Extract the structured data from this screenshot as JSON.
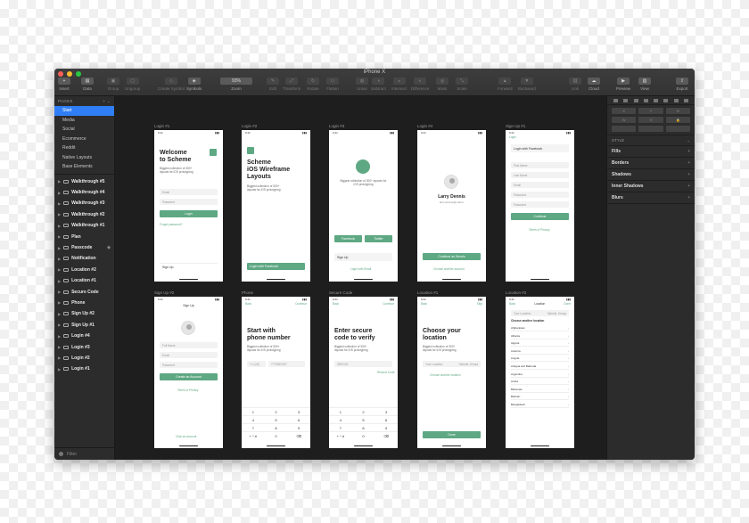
{
  "window": {
    "title": "iPhone X",
    "toolbar": [
      {
        "label": "Insert",
        "icon": "+"
      },
      {
        "label": "Data",
        "icon": "▤"
      },
      {
        "label": "Group",
        "icon": "▣"
      },
      {
        "label": "Ungroup",
        "icon": "▢"
      },
      {
        "label": "Create Symbol",
        "icon": "◇"
      },
      {
        "label": "Symbols",
        "icon": "◈"
      },
      {
        "label": "Zoom",
        "icon": "93%"
      },
      {
        "label": "Edit",
        "icon": "✎"
      },
      {
        "label": "Transform",
        "icon": "⤢"
      },
      {
        "label": "Rotate",
        "icon": "↻"
      },
      {
        "label": "Flatten",
        "icon": "▭"
      },
      {
        "label": "Union",
        "icon": "◍"
      },
      {
        "label": "Subtract",
        "icon": "◑"
      },
      {
        "label": "Intersect",
        "icon": "◒"
      },
      {
        "label": "Difference",
        "icon": "◐"
      },
      {
        "label": "Mask",
        "icon": "◎"
      },
      {
        "label": "Scale",
        "icon": "⤡"
      },
      {
        "label": "Forward",
        "icon": "▲"
      },
      {
        "label": "Backward",
        "icon": "▼"
      },
      {
        "label": "Link",
        "icon": "⛓"
      },
      {
        "label": "Cloud",
        "icon": "☁"
      },
      {
        "label": "Preview",
        "icon": "▶"
      },
      {
        "label": "View",
        "icon": "▥"
      },
      {
        "label": "Export",
        "icon": "⇪"
      }
    ]
  },
  "sidebar": {
    "pages_header": "PAGES",
    "pages": [
      "Start",
      "Media",
      "Social",
      "Ecommerce",
      "Reddit",
      "Native Layouts",
      "Base Elements"
    ],
    "layers": [
      {
        "name": "Walkthrough #5"
      },
      {
        "name": "Walkthrough #4"
      },
      {
        "name": "Walkthrough #3"
      },
      {
        "name": "Walkthrough #2"
      },
      {
        "name": "Walkthrough #1"
      },
      {
        "name": "Plan"
      },
      {
        "name": "Passcode"
      },
      {
        "name": "Notification"
      },
      {
        "name": "Location #2"
      },
      {
        "name": "Location #1"
      },
      {
        "name": "Secure Code"
      },
      {
        "name": "Phone"
      },
      {
        "name": "Sign Up #2"
      },
      {
        "name": "Sign Up #1"
      },
      {
        "name": "Login #4"
      },
      {
        "name": "Login #3"
      },
      {
        "name": "Login #2"
      },
      {
        "name": "Login #1"
      }
    ],
    "filter": "Filter"
  },
  "artboards": {
    "login1": {
      "name": "Login #1",
      "title1": "Welcome",
      "title2": "to Scheme",
      "sub": "Biggest collection of 300+ layouts for iOS prototyping",
      "email": "Email",
      "password": "Password",
      "btn": "Login",
      "forgot": "Forgot password?",
      "signup": "Sign Up"
    },
    "login2": {
      "name": "Login #2",
      "title1": "Scheme",
      "title2": "iOS Wireframe",
      "title3": "Layouts",
      "sub": "Biggest collection of 300+ layouts for iOS prototyping",
      "fb": "Login with Facebook"
    },
    "login3": {
      "name": "Login #3",
      "sub": "Biggest collection of 300+ layouts for iOS prototyping",
      "facebook": "Facebook",
      "twitter": "Twitter",
      "signup": "Sign Up",
      "email": "Login with Email"
    },
    "login4": {
      "name": "Login #4",
      "user": "Larry Dennis",
      "email": "larry.dennis@mail.io",
      "btn": "Continue as Dennis",
      "other": "Choose another account"
    },
    "signup1": {
      "name": "Sign Up #1",
      "back": "Login",
      "fb": "Login with Facebook",
      "first": "First Name",
      "last": "Last Name",
      "email": "Email",
      "password": "Password",
      "confirm": "Password",
      "btn": "Continue",
      "terms": "Terms of Privacy"
    },
    "signup2": {
      "name": "Sign Up #2",
      "title": "Sign Up",
      "full": "Full Name",
      "email": "Email",
      "password": "Password",
      "btn": "Create an Account",
      "terms": "Terms of Privacy",
      "login": "Click an account"
    },
    "phone": {
      "name": "Phone",
      "back": "Back",
      "next": "Continue",
      "title1": "Start with",
      "title2": "phone number",
      "sub": "Biggest collection of 300+ layouts for iOS prototyping",
      "code": "+1 (US)",
      "number": "7775567457",
      "keys": [
        "1",
        "2",
        "3",
        "4",
        "5",
        "6",
        "7",
        "8",
        "9",
        "+ * #",
        "0",
        "⌫"
      ]
    },
    "secure": {
      "name": "Secure Code",
      "back": "Back",
      "next": "Continue",
      "title1": "Enter secure",
      "title2": "code to verify",
      "sub": "Biggest collection of 300+ layouts for iOS prototyping",
      "code": "3902129",
      "resend": "Resend Code",
      "keys": [
        "1",
        "2",
        "3",
        "4",
        "5",
        "6",
        "7",
        "8",
        "9",
        "+ * #",
        "0",
        "⌫"
      ]
    },
    "loc1": {
      "name": "Location #1",
      "back": "Back",
      "skip": "Skip",
      "title1": "Choose your",
      "title2": "location",
      "sub": "Biggest collection of 300+ layouts for iOS prototyping",
      "field": "Your Location",
      "value": "Nairobi, Kenya",
      "other": "Choose another location",
      "btn": "Done"
    },
    "loc2": {
      "name": "Location #2",
      "back": "Back",
      "title": "Location",
      "done": "Done",
      "field": "Your Location",
      "value": "Nairobi, Kenya",
      "header": "Choose another location",
      "countries": [
        "Afghanistan",
        "Albania",
        "Algeria",
        "Andorra",
        "Angola",
        "Antigua and Barbuda",
        "Argentina",
        "Aruba",
        "Bahamas",
        "Bahrain",
        "Bangladesh"
      ]
    }
  },
  "inspector": {
    "style_header": "STYLE",
    "sections": [
      "Fills",
      "Borders",
      "Shadows",
      "Inner Shadows",
      "Blurs"
    ]
  }
}
